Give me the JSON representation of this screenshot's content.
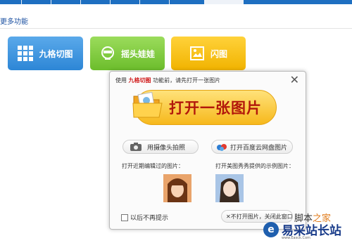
{
  "section": {
    "title": "更多功能"
  },
  "features": [
    {
      "label": "九格切图",
      "icon": "grid-icon"
    },
    {
      "label": "摇头娃娃",
      "icon": "bobblehead-icon"
    },
    {
      "label": "闪图",
      "icon": "flash-image-icon"
    }
  ],
  "dialog": {
    "prompt_prefix": "使用",
    "prompt_highlight": "九格切图",
    "prompt_suffix": "功能前，请先打开一张图片",
    "open_button": "打开一张图片",
    "camera_button": "用摄像头拍照",
    "cloud_button": "打开百度云网盘图片",
    "recent_label": "打开近期编辑过的图片：",
    "sample_label": "打开美图秀秀提供的示例图片：",
    "no_prompt_checkbox": "以后不再提示",
    "close_button": "不打开图片，关闭此窗口"
  },
  "watermarks": {
    "site1_black": "脚本",
    "site1_orange": "之家",
    "site2": "易采站长站",
    "site2_small": "www.Easck.Com"
  },
  "colors": {
    "accent": "#1e6fc1",
    "highlight": "#d01a1a",
    "open_button": "#f6b81c"
  }
}
